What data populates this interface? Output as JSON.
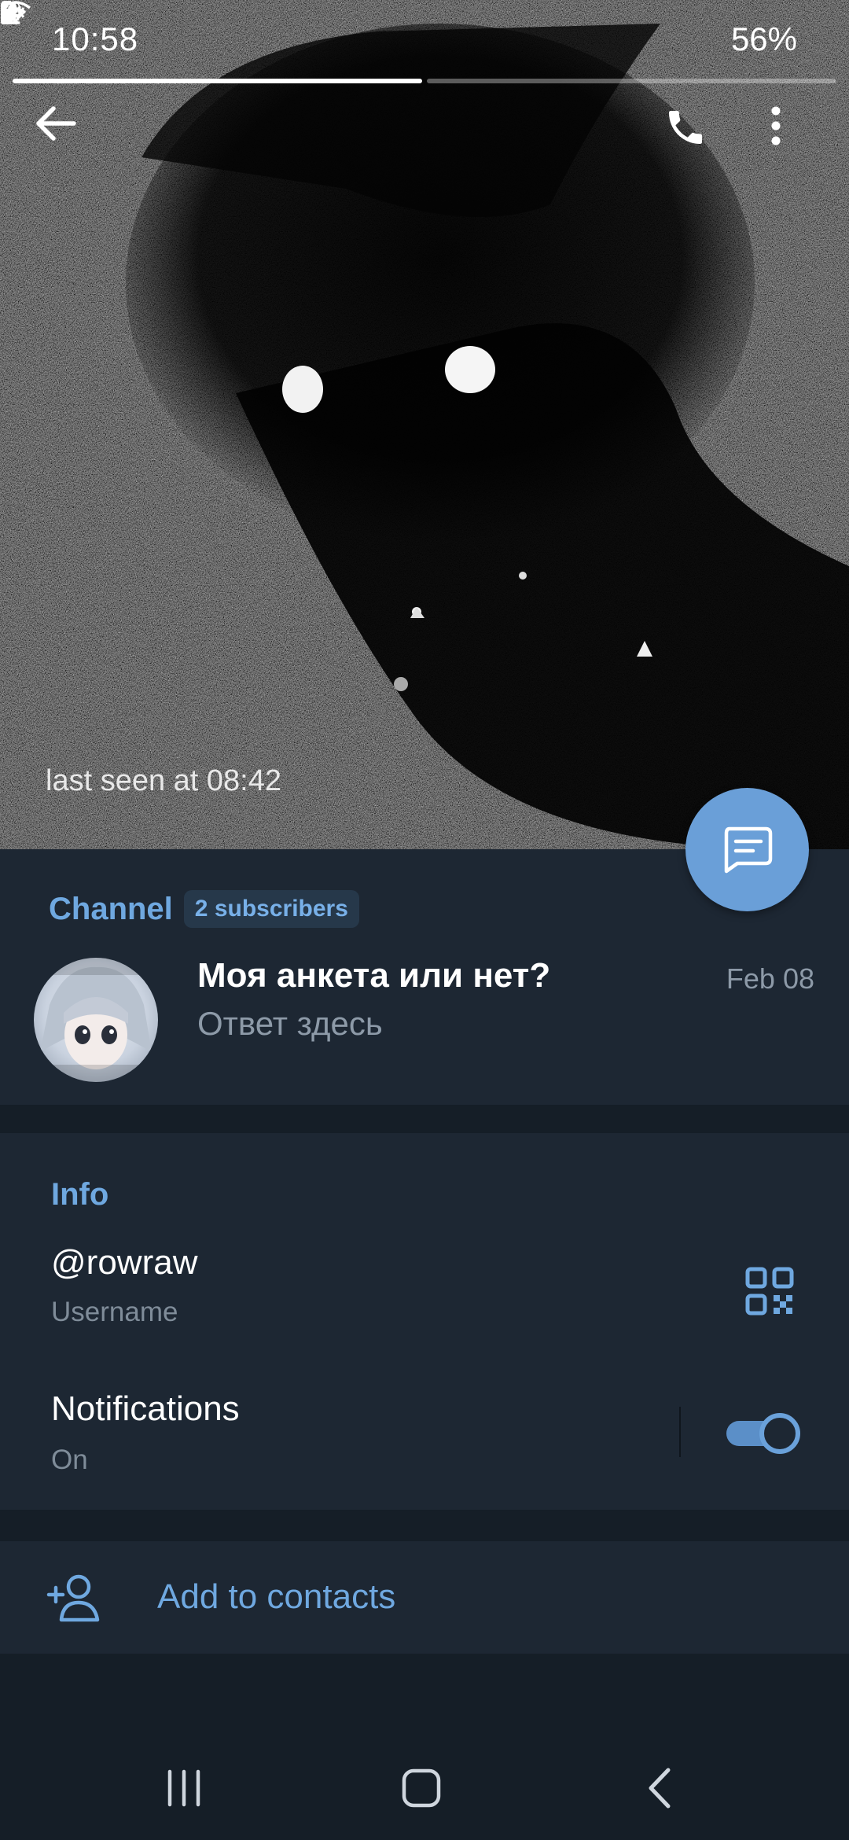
{
  "status_bar": {
    "time": "10:58",
    "battery": "56%",
    "left_icons": [
      "missed-signal-icon",
      "pause-icon",
      "download-icon",
      "dot-icon"
    ],
    "right_icons": [
      "mute-icon",
      "wifi-icon",
      "volte-icon",
      "signal-icon",
      "battery-icon"
    ]
  },
  "header": {
    "last_seen": "last seen at 08:42",
    "story_segments": 2,
    "active_segment": 1
  },
  "channel": {
    "title": "Channel",
    "subscribers": "2 subscribers",
    "post_title": "Моя анкета или нет?",
    "post_subtitle": "Ответ здесь",
    "post_date": "Feb 08"
  },
  "info": {
    "title": "Info",
    "username": "@rowraw",
    "username_label": "Username",
    "notifications_label": "Notifications",
    "notifications_value": "On",
    "notifications_on": true
  },
  "actions": {
    "add_contact": "Add to contacts"
  },
  "colors": {
    "accent": "#6fa8e0",
    "background": "#1d2733",
    "divider": "#151e27",
    "fab": "#6a9fd8"
  }
}
